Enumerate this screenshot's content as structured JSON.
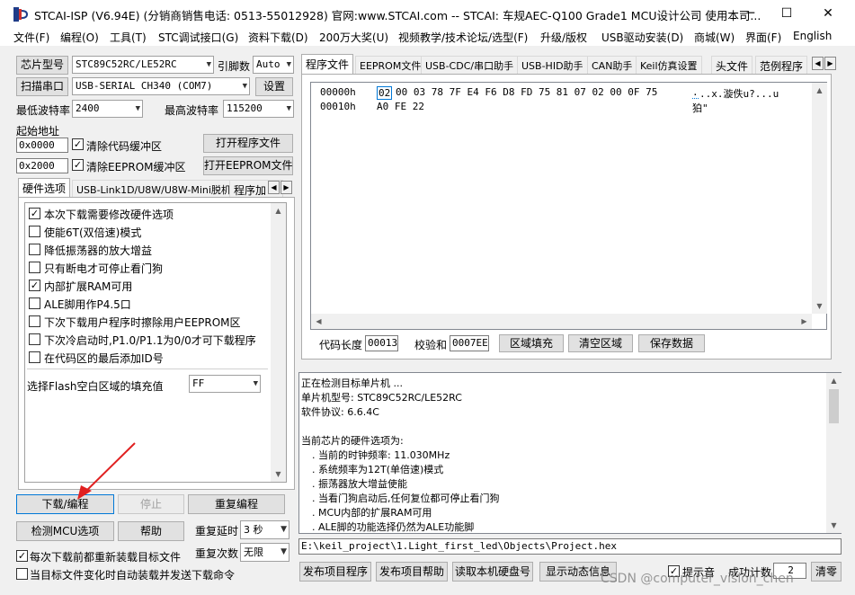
{
  "title": "STCAI-ISP (V6.94E) (分销商销售电话: 0513-55012928) 官网:www.STCAI.com  -- STCAI: 车规AEC-Q100 Grade1 MCU设计公司 使用本司...",
  "window_controls": {
    "minimize": "─",
    "maximize": "☐",
    "close": "✕"
  },
  "menu": [
    "文件(F)",
    "编程(O)",
    "工具(T)",
    "STC调试接口(G)",
    "资料下载(D)",
    "200万大奖(U)",
    "视频教学/技术论坛/选型(F)",
    "升级/版权",
    "USB驱动安装(D)",
    "商城(W)",
    "界面(F)",
    "English"
  ],
  "left": {
    "chip_btn": "芯片型号",
    "chip_value": "STC89C52RC/LE52RC",
    "pin_label": "引脚数",
    "pin_value": "Auto",
    "scan_btn": "扫描串口",
    "port_value": "USB-SERIAL CH340 (COM7)",
    "settings_btn": "设置",
    "min_baud_label": "最低波特率",
    "min_baud_value": "2400",
    "max_baud_label": "最高波特率",
    "max_baud_value": "115200",
    "start_addr_label": "起始地址",
    "addr1": "0x0000",
    "clear_code_label": "清除代码缓冲区",
    "open_prog_btn": "打开程序文件",
    "addr2": "0x2000",
    "clear_eeprom_label": "清除EEPROM缓冲区",
    "open_eeprom_btn": "打开EEPROM文件",
    "tabs": [
      "硬件选项",
      "USB-Link1D/U8W/U8W-Mini脱机",
      "程序加"
    ],
    "options": [
      {
        "label": "本次下载需要修改硬件选项",
        "checked": "✓"
      },
      {
        "label": "使能6T(双倍速)模式",
        "checked": ""
      },
      {
        "label": "降低振荡器的放大增益",
        "checked": ""
      },
      {
        "label": "只有断电才可停止看门狗",
        "checked": ""
      },
      {
        "label": "内部扩展RAM可用",
        "checked": "✓"
      },
      {
        "label": "ALE脚用作P4.5口",
        "checked": ""
      },
      {
        "label": "下次下载用户程序时擦除用户EEPROM区",
        "checked": ""
      },
      {
        "label": "下次冷启动时,P1.0/P1.1为0/0才可下载程序",
        "checked": ""
      },
      {
        "label": "在代码区的最后添加ID号",
        "checked": ""
      }
    ],
    "fill_label": "选择Flash空白区域的填充值",
    "fill_value": "FF",
    "download_btn": "下载/编程",
    "stop_btn": "停止",
    "reprogram_btn": "重复编程",
    "detect_btn": "检测MCU选项",
    "help_btn": "帮助",
    "repeat_delay_label": "重复延时",
    "repeat_delay_value": "3 秒",
    "repeat_count_label": "重复次数",
    "repeat_count_value": "无限",
    "reload_label": "每次下载前都重新装载目标文件",
    "auto_send_label": "当目标文件变化时自动装载并发送下载命令",
    "reload_checked": "✓",
    "auto_send_checked": ""
  },
  "right": {
    "tabs": [
      "程序文件",
      "EEPROM文件",
      "USB-CDC/串口助手",
      "USB-HID助手",
      "CAN助手",
      "Keil仿真设置",
      "头文件",
      "范例程序"
    ],
    "hex_rows": [
      {
        "addr": "00000h",
        "first": "02",
        "bytes": "00 03 78 7F E4 F6 D8 FD 75 81 07 02 00 0F 75",
        "ascii_first": ".",
        "ascii": "..x.漩佚u?...u"
      },
      {
        "addr": "00010h",
        "first": "",
        "bytes": "A0 FE 22",
        "ascii_first": "",
        "ascii": "狛\""
      }
    ],
    "code_len_label": "代码长度",
    "code_len_value": "00013",
    "checksum_label": "校验和",
    "checksum_value": "0007EE",
    "fill_area_btn": "区域填充",
    "clear_area_btn": "清空区域",
    "save_btn": "保存数据",
    "log": [
      "正在检测目标单片机 ...",
      "  单片机型号: STC89C52RC/LE52RC",
      "  软件协议: 6.6.4C",
      "",
      "当前芯片的硬件选项为:",
      "  . 当前的时钟频率: 11.030MHz",
      "  . 系统频率为12T(单倍速)模式",
      "  . 振荡器放大增益使能",
      "  . 当看门狗启动后,任何复位都可停止看门狗",
      "  . MCU内部的扩展RAM可用",
      "  . ALE脚的功能选择仍然为ALE功能脚"
    ],
    "path": "E:\\keil_project\\1.Light_first_led\\Objects\\Project.hex",
    "publish_prog_btn": "发布项目程序",
    "publish_help_btn": "发布项目帮助",
    "read_disk_btn": "读取本机硬盘号",
    "show_dynamic_btn": "显示动态信息",
    "beep_label": "提示音",
    "beep_checked": "✓",
    "success_label": "成功计数",
    "success_value": "2",
    "clear_btn": "清零"
  },
  "watermark": "CSDN @computer_vision_chen",
  "colors": {
    "accent": "#0078d7",
    "arrow": "#e02020",
    "window_border": "#adadad"
  }
}
